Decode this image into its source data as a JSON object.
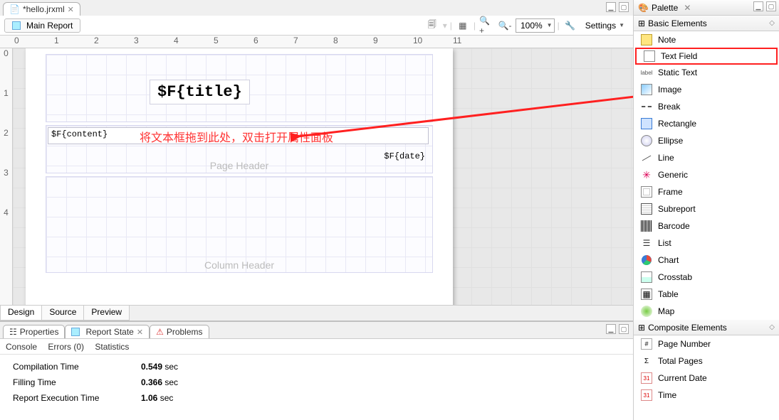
{
  "editor": {
    "tab_title": "*hello.jrxml",
    "main_report_label": "Main Report",
    "zoom": "100%",
    "settings_label": "Settings",
    "ruler_h": [
      "0",
      "1",
      "2",
      "3",
      "4",
      "5",
      "6",
      "7",
      "8",
      "9",
      "10",
      "11"
    ],
    "ruler_v": [
      "0",
      "1",
      "2",
      "3",
      "4"
    ],
    "fields": {
      "title": "$F{title}",
      "content": "$F{content}",
      "date": "$F{date}"
    },
    "band_labels": {
      "page_header": "Page Header",
      "column_header": "Column Header"
    },
    "annotation": "将文本框拖到此处，双击打开属性面板",
    "mode_tabs": [
      "Design",
      "Source",
      "Preview"
    ]
  },
  "bottom": {
    "tabs": [
      "Properties",
      "Report State",
      "Problems"
    ],
    "subtabs": [
      "Console",
      "Errors (0)",
      "Statistics"
    ],
    "stats": [
      {
        "label": "Compilation Time",
        "value": "0.549",
        "unit": "sec"
      },
      {
        "label": "Filling Time",
        "value": "0.366",
        "unit": "sec"
      },
      {
        "label": "Report Execution Time",
        "value": "1.06",
        "unit": "sec"
      }
    ]
  },
  "palette": {
    "title": "Palette",
    "basic_section": "Basic Elements",
    "composite_section": "Composite Elements",
    "basic": [
      {
        "label": "Note",
        "icon": "note"
      },
      {
        "label": "Text Field",
        "icon": "text",
        "highlight": true
      },
      {
        "label": "Static Text",
        "icon": "static"
      },
      {
        "label": "Image",
        "icon": "image"
      },
      {
        "label": "Break",
        "icon": "break"
      },
      {
        "label": "Rectangle",
        "icon": "rect"
      },
      {
        "label": "Ellipse",
        "icon": "ellipse"
      },
      {
        "label": "Line",
        "icon": "line"
      },
      {
        "label": "Generic",
        "icon": "generic"
      },
      {
        "label": "Frame",
        "icon": "frame"
      },
      {
        "label": "Subreport",
        "icon": "subreport"
      },
      {
        "label": "Barcode",
        "icon": "barcode"
      },
      {
        "label": "List",
        "icon": "list"
      },
      {
        "label": "Chart",
        "icon": "chart"
      },
      {
        "label": "Crosstab",
        "icon": "crosstab"
      },
      {
        "label": "Table",
        "icon": "table"
      },
      {
        "label": "Map",
        "icon": "map"
      }
    ],
    "composite": [
      {
        "label": "Page Number",
        "icon": "pagenum"
      },
      {
        "label": "Total Pages",
        "icon": "totalpages"
      },
      {
        "label": "Current Date",
        "icon": "date"
      },
      {
        "label": "Time",
        "icon": "date"
      }
    ]
  }
}
